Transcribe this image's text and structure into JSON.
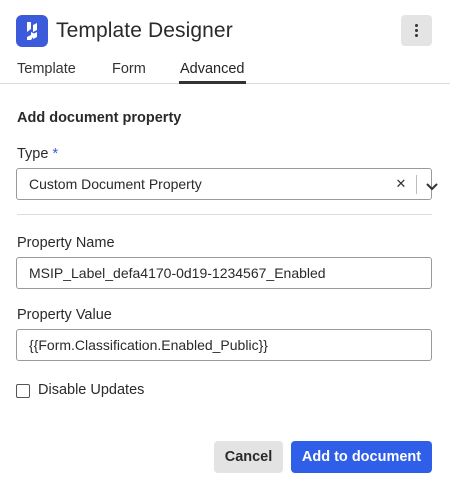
{
  "header": {
    "title": "Template Designer",
    "logo_icon": "app-logo-icon",
    "menu_icon": "more-vertical-icon",
    "accent_color": "#3b5bdb"
  },
  "tabs": [
    {
      "label": "Template",
      "active": false
    },
    {
      "label": "Form",
      "active": false
    },
    {
      "label": "Advanced",
      "active": true
    }
  ],
  "section": {
    "title": "Add document property"
  },
  "type_field": {
    "label": "Type",
    "required_marker": "*",
    "selected_value": "Custom Document Property",
    "clear_icon": "close-icon",
    "dropdown_icon": "chevron-down-icon"
  },
  "property_name": {
    "label": "Property Name",
    "value": "MSIP_Label_defa4170-0d19-1234567_Enabled"
  },
  "property_value": {
    "label": "Property Value",
    "value": "{{Form.Classification.Enabled_Public}}"
  },
  "disable_updates": {
    "label": "Disable Updates",
    "checked": false
  },
  "actions": {
    "cancel_label": "Cancel",
    "submit_label": "Add to document",
    "primary_color": "#2f5ee8"
  }
}
